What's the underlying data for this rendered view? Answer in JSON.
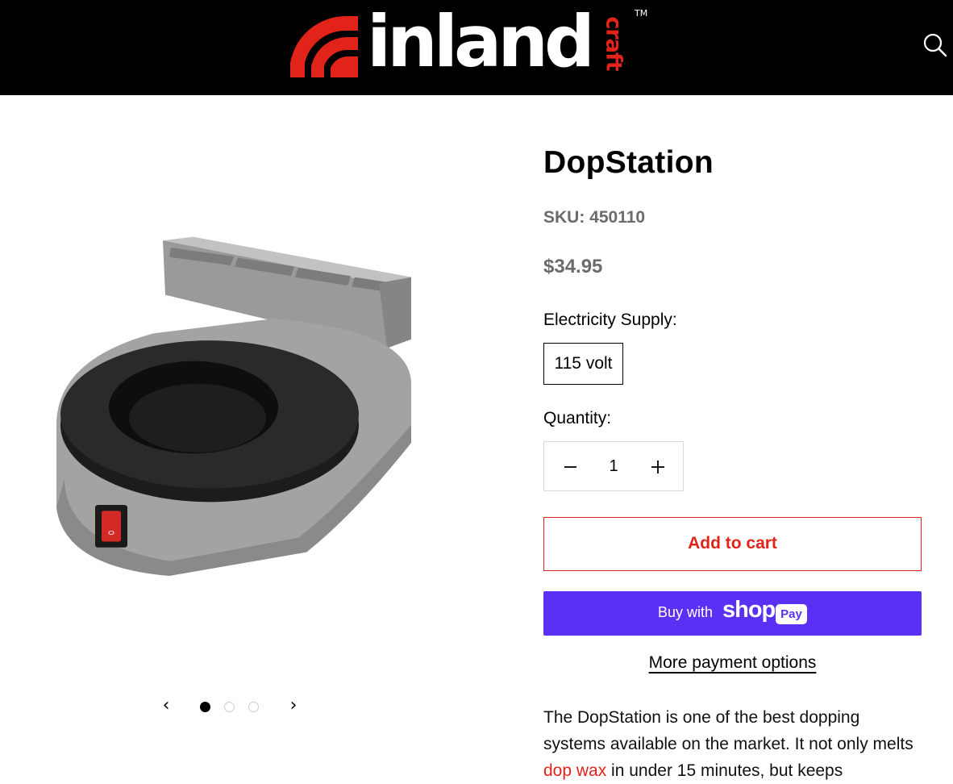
{
  "header": {
    "logo_word": "inland",
    "logo_suffix": "craft",
    "logo_trademark": "TM",
    "search_icon": "search-icon",
    "colors": {
      "background": "#000000",
      "accent": "#e2231a"
    }
  },
  "gallery": {
    "image_alt": "DopStation",
    "prev_icon": "chevron-left-icon",
    "next_icon": "chevron-right-icon",
    "prev_glyph": "‹",
    "next_glyph": "›",
    "slide_count": 3,
    "active_slide": 1
  },
  "product": {
    "title": "DopStation",
    "sku": "SKU: 450110",
    "price": "$34.95",
    "supply_label": "Electricity Supply:",
    "supply_option": "115 volt",
    "quantity_label": "Quantity:",
    "quantity_value": "1",
    "add_to_cart": "Add to cart",
    "shop_pay": {
      "buy_with": "Buy with",
      "shop": "shop",
      "pay": "Pay",
      "color": "#5a31f4"
    },
    "more_payment": "More payment options",
    "description": {
      "part1": "The DopStation is one of the best dopping systems available on the market. It not only melts ",
      "link": "dop wax",
      "part2": " in under 15 minutes, but keeps"
    }
  }
}
